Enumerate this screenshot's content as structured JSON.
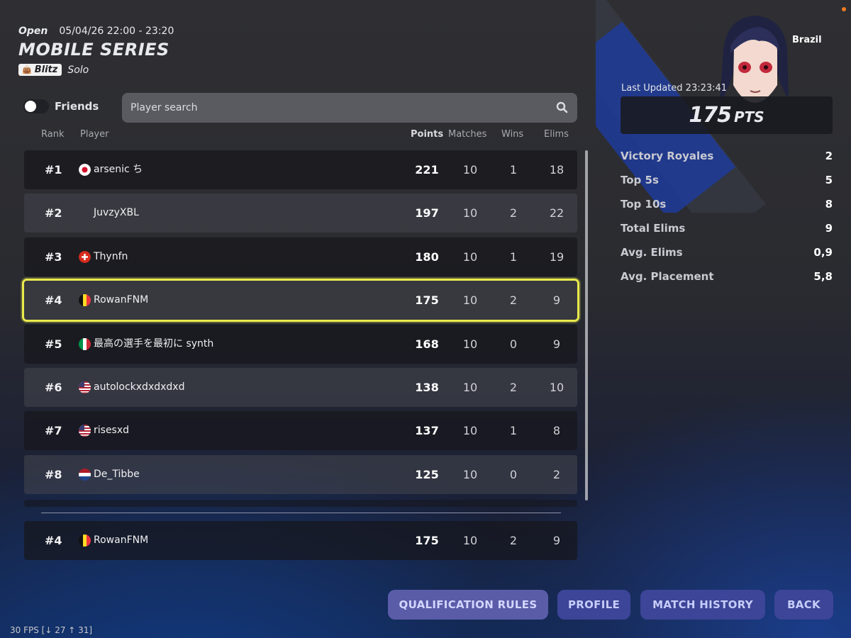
{
  "header": {
    "status": "Open",
    "time": "05/04/26 22:00 - 23:20",
    "title": "MOBILE SERIES",
    "badge": "Blitz",
    "badge_icon": "blitz-bag-icon",
    "mode": "Solo"
  },
  "friends": {
    "label": "Friends",
    "enabled": false
  },
  "search": {
    "placeholder": "Player search",
    "icon": "search-icon"
  },
  "columns": {
    "rank": "Rank",
    "player": "Player",
    "points": "Points",
    "matches": "Matches",
    "wins": "Wins",
    "elims": "Elims"
  },
  "rows": [
    {
      "rank": "#1",
      "flag": "japan",
      "name": "arsenic ち",
      "points": "221",
      "matches": "10",
      "wins": "1",
      "elims": "18"
    },
    {
      "rank": "#2",
      "flag": "",
      "name": "JuvzyXBL",
      "points": "197",
      "matches": "10",
      "wins": "2",
      "elims": "22"
    },
    {
      "rank": "#3",
      "flag": "switzerland",
      "name": "Thynfn",
      "points": "180",
      "matches": "10",
      "wins": "1",
      "elims": "19"
    },
    {
      "rank": "#4",
      "flag": "belgium",
      "name": "RowanFNM",
      "points": "175",
      "matches": "10",
      "wins": "2",
      "elims": "9"
    },
    {
      "rank": "#5",
      "flag": "italy",
      "name": "最高の選手を最初に synth",
      "points": "168",
      "matches": "10",
      "wins": "0",
      "elims": "9"
    },
    {
      "rank": "#6",
      "flag": "usa",
      "name": "autolockxdxdxdxd",
      "points": "138",
      "matches": "10",
      "wins": "2",
      "elims": "10"
    },
    {
      "rank": "#7",
      "flag": "usa",
      "name": "risesxd",
      "points": "137",
      "matches": "10",
      "wins": "1",
      "elims": "8"
    },
    {
      "rank": "#8",
      "flag": "netherlands",
      "name": "De_Tibbe",
      "points": "125",
      "matches": "10",
      "wins": "0",
      "elims": "2"
    }
  ],
  "current_player": {
    "rank": "#4",
    "flag": "belgium",
    "name": "RowanFNM",
    "points": "175",
    "matches": "10",
    "wins": "2",
    "elims": "9"
  },
  "profile": {
    "region": "Brazil",
    "last_updated": "Last Updated 23:23:41",
    "points_value": "175",
    "points_unit": "PTS",
    "stats": [
      {
        "label": "Victory Royales",
        "value": "2"
      },
      {
        "label": "Top 5s",
        "value": "5"
      },
      {
        "label": "Top 10s",
        "value": "8"
      },
      {
        "label": "Total Elims",
        "value": "9"
      },
      {
        "label": "Avg. Elims",
        "value": "0,9"
      },
      {
        "label": "Avg. Placement",
        "value": "5,8"
      }
    ]
  },
  "buttons": {
    "qualification_rules": "QUALIFICATION RULES",
    "profile": "PROFILE",
    "match_history": "MATCH HISTORY",
    "back": "BACK"
  },
  "fps": "30 FPS [↓ 27 ↑ 31]",
  "colors": {
    "highlight": "#e9ea4c",
    "button": "#3c4597",
    "button_primary": "#5a5ca8"
  }
}
